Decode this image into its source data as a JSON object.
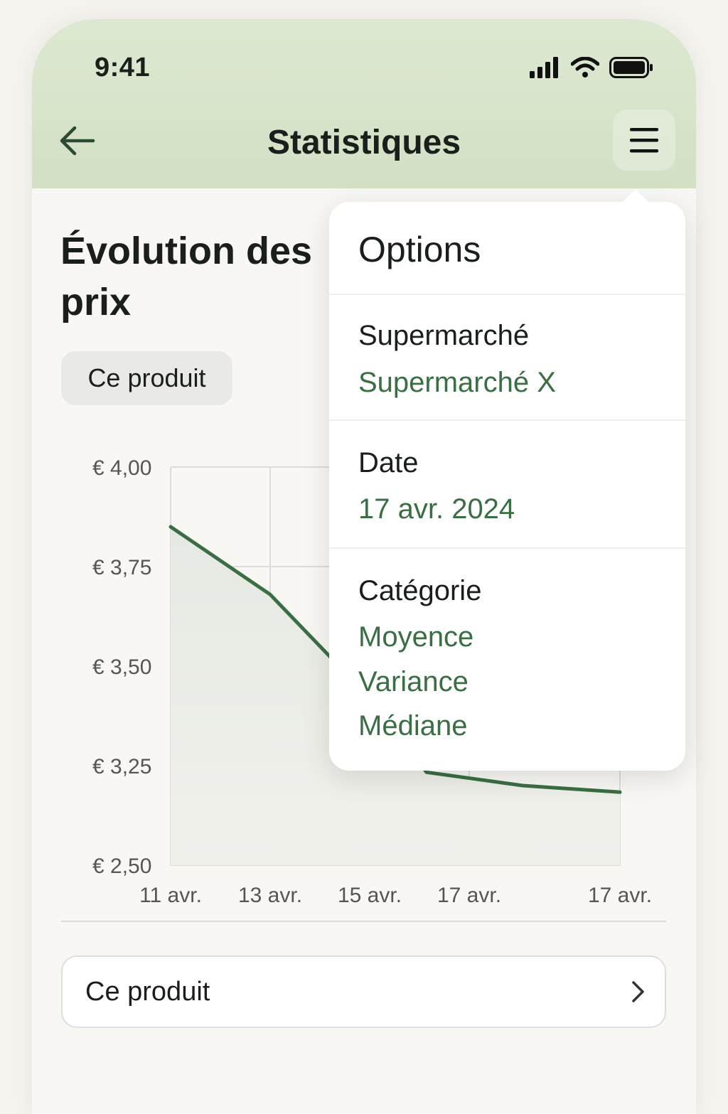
{
  "status": {
    "time": "9:41"
  },
  "header": {
    "title": "Statistiques"
  },
  "section": {
    "title_line1": "Évolution des",
    "title_line2": "prix",
    "filter_chip": "Ce produit"
  },
  "chart_data": {
    "type": "line",
    "y_tick_labels": [
      "€ 4,00",
      "€ 3,75",
      "€ 3,50",
      "€ 3,25",
      "€ 2,50"
    ],
    "x_tick_labels": [
      "11 avr.",
      "13 avr.",
      "15 avr.",
      "17 avr.",
      "17 avr."
    ],
    "series": [
      {
        "values": [
          3.85,
          3.68,
          3.42,
          3.2,
          3.1,
          3.05
        ]
      }
    ],
    "line_color": "#3a6e43",
    "grid": true
  },
  "bottom": {
    "product_row_label": "Ce produit"
  },
  "dropdown": {
    "title": "Options",
    "supermarket_label": "Supermarché",
    "supermarket_value": "Supermarché X",
    "date_label": "Date",
    "date_value": "17 avr. 2024",
    "category_label": "Catégorie",
    "category_options": [
      "Moyence",
      "Variance",
      "Médiane"
    ]
  },
  "colors": {
    "accent": "#3a6e43",
    "header_bg": "#dae5cd"
  }
}
